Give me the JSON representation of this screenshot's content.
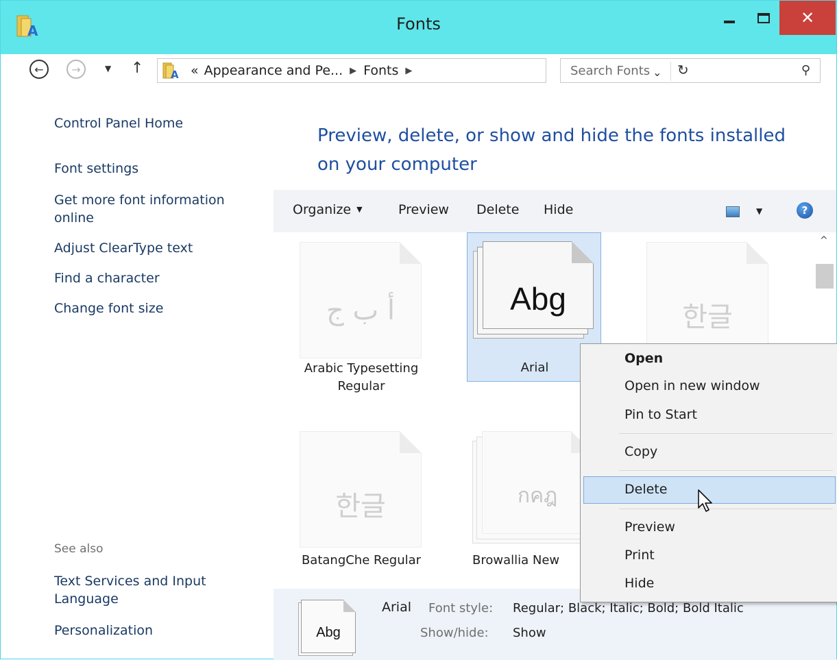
{
  "window": {
    "title": "Fonts"
  },
  "nav": {
    "breadcrumb": [
      "Appearance and Pe...",
      "Fonts"
    ],
    "address_prefix": "«",
    "search_placeholder": "Search Fonts"
  },
  "sidebar": {
    "links": [
      "Control Panel Home",
      "Font settings",
      "Get more font information online",
      "Adjust ClearType text",
      "Find a character",
      "Change font size"
    ],
    "see_also_label": "See also",
    "see_also_links": [
      "Text Services and Input Language",
      "Personalization"
    ]
  },
  "main": {
    "heading": "Preview, delete, or show and hide the fonts installed on your computer",
    "toolbar": {
      "organize": "Organize",
      "preview": "Preview",
      "delete": "Delete",
      "hide": "Hide"
    },
    "fonts": [
      {
        "name": "Arabic Typesetting Regular",
        "glyph": "أ ب ج",
        "selected": false
      },
      {
        "name": "Arial",
        "glyph": "Abg",
        "selected": true
      },
      {
        "name": "",
        "glyph": "한글",
        "selected": false
      },
      {
        "name": "BatangChe Regular",
        "glyph": "한글",
        "selected": false
      },
      {
        "name": "Browallia New",
        "glyph": "กคฎ",
        "selected": false
      }
    ]
  },
  "details": {
    "name": "Arial",
    "preview_glyph": "Abg",
    "font_style_label": "Font style:",
    "font_style_value": "Regular; Black; Italic; Bold; Bold Italic",
    "show_hide_label": "Show/hide:",
    "show_hide_value": "Show"
  },
  "context_menu": {
    "items": [
      "Open",
      "Open in new window",
      "Pin to Start",
      "Copy",
      "Delete",
      "Preview",
      "Print",
      "Hide"
    ],
    "highlighted": "Delete"
  },
  "colors": {
    "titlebar": "#5ee6ea",
    "close": "#c9413a",
    "heading": "#1f4fa0",
    "selection": "#d7e7f8"
  }
}
